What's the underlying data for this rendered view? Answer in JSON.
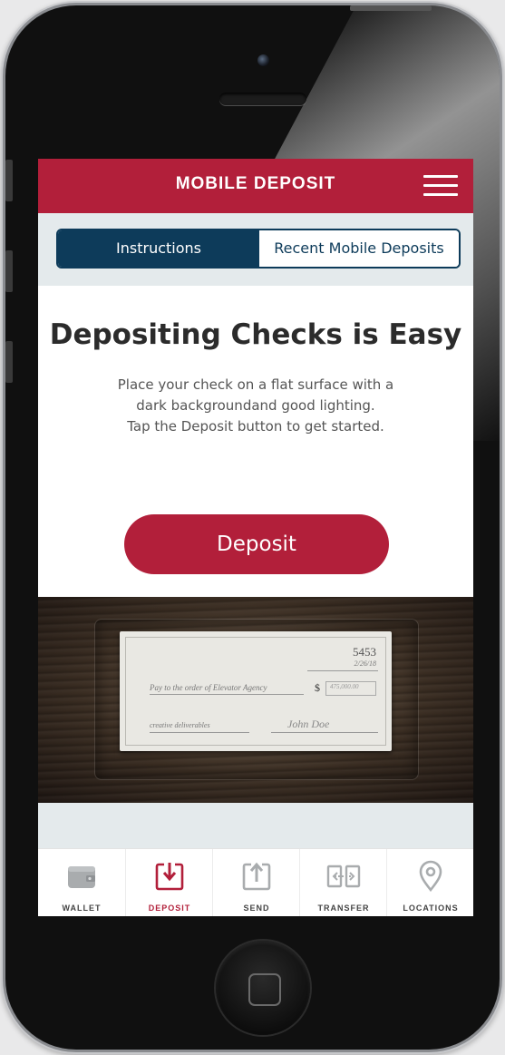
{
  "colors": {
    "brand_red": "#b21f3a",
    "navy": "#0d3b5a",
    "tab_inactive_icon": "#a9acae"
  },
  "header": {
    "title": "MOBILE DEPOSIT",
    "menu_icon": "hamburger-menu-icon"
  },
  "segmented": {
    "tabs": [
      {
        "label": "Instructions",
        "selected": true
      },
      {
        "label": "Recent Mobile Deposits",
        "selected": false
      }
    ]
  },
  "main": {
    "headline": "Depositing Checks is Easy",
    "description": [
      "Place your check on a flat surface with a",
      "dark backgroundand good lighting.",
      "Tap the Deposit button to get started."
    ],
    "deposit_button": "Deposit"
  },
  "check": {
    "number": "5453",
    "date": "2/26/18",
    "pay_to": "Pay to the order of Elevator Agency",
    "dollar_sign": "$",
    "amount": "475,000.00",
    "memo": "creative deliverables",
    "signature": "John Doe"
  },
  "tabbar": {
    "items": [
      {
        "label": "WALLET",
        "icon": "wallet-icon",
        "active": false
      },
      {
        "label": "DEPOSIT",
        "icon": "deposit-icon",
        "active": true
      },
      {
        "label": "SEND",
        "icon": "send-icon",
        "active": false
      },
      {
        "label": "TRANSFER",
        "icon": "transfer-icon",
        "active": false
      },
      {
        "label": "LOCATIONS",
        "icon": "location-pin-icon",
        "active": false
      }
    ]
  }
}
